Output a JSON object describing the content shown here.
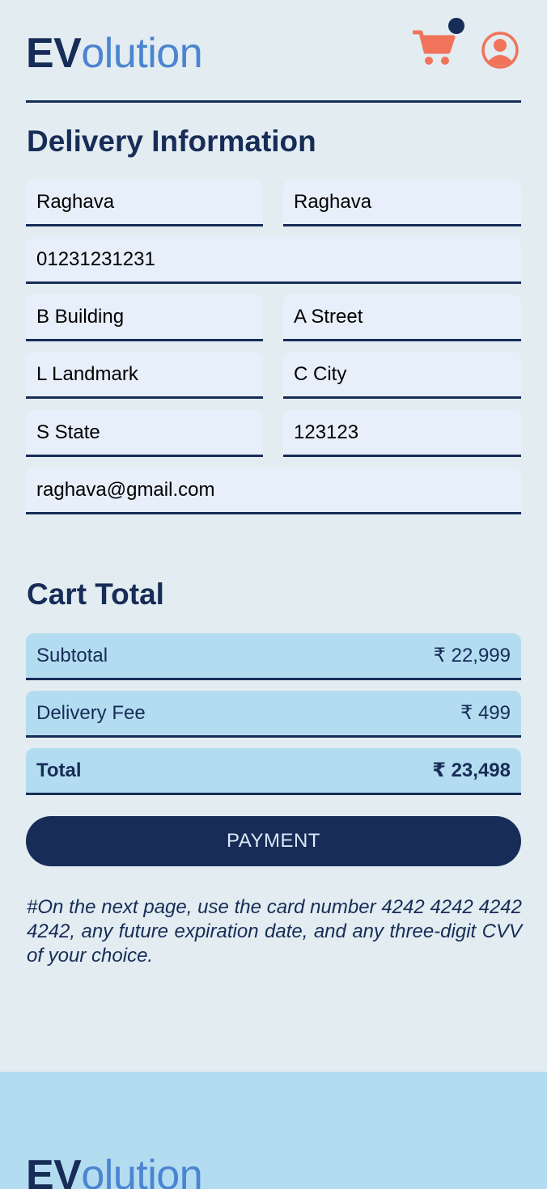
{
  "header": {
    "logo_bold": "EV",
    "logo_rest": "olution",
    "icons": {
      "cart": "shopping-cart-icon",
      "profile": "user-circle-icon"
    },
    "has_cart_badge": true
  },
  "delivery": {
    "title": "Delivery Information",
    "fields": {
      "first_name": "Raghava",
      "last_name": "Raghava",
      "phone": "01231231231",
      "building": "B Building",
      "street": "A Street",
      "landmark": "L Landmark",
      "city": "C City",
      "state": "S State",
      "pincode": "123123",
      "email": "raghava@gmail.com"
    }
  },
  "cart": {
    "title": "Cart Total",
    "subtotal_label": "Subtotal",
    "subtotal_value": "₹ 22,999",
    "delivery_label": "Delivery Fee",
    "delivery_value": "₹ 499",
    "total_label": "Total",
    "total_value": "₹ 23,498",
    "button_label": "PAYMENT"
  },
  "note": "#On the next page, use the card number 4242 4242 4242 4242, any future expiration date, and any three-digit CVV of your choice.",
  "footer": {
    "logo_bold": "EV",
    "logo_rest": "olution"
  },
  "colors": {
    "background": "#e2ecf1",
    "navy": "#172c57",
    "accent_orange": "#f0735a",
    "input_bg": "#e7effb",
    "cart_row_bg": "#b3dcf0",
    "logo_blue": "#4b84d0"
  }
}
